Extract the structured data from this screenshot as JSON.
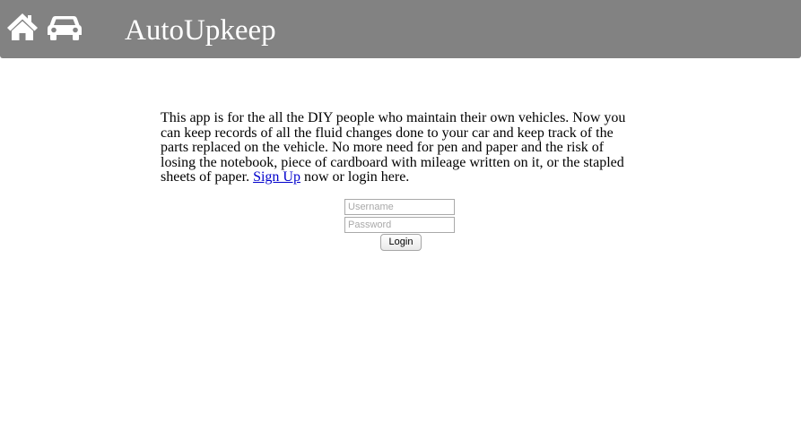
{
  "header": {
    "home_icon": "home-icon",
    "car_icon": "car-icon",
    "title": "AutoUpkeep",
    "background_color": "#828282"
  },
  "intro": {
    "text_before_link": "This app is for the all the DIY people who maintain their own vehicles. Now you can keep records of all the fluid changes done to your car and keep track of the parts replaced on the vehicle. No more need for pen and paper and the risk of losing the notebook, piece of cardboard with mileage written on it, or the stapled sheets of paper. ",
    "signup_link": "Sign Up",
    "text_after_link": " now or login here.",
    "link_color": "#0000cc"
  },
  "login": {
    "username_placeholder": "Username",
    "password_placeholder": "Password",
    "button_label": "Login"
  }
}
